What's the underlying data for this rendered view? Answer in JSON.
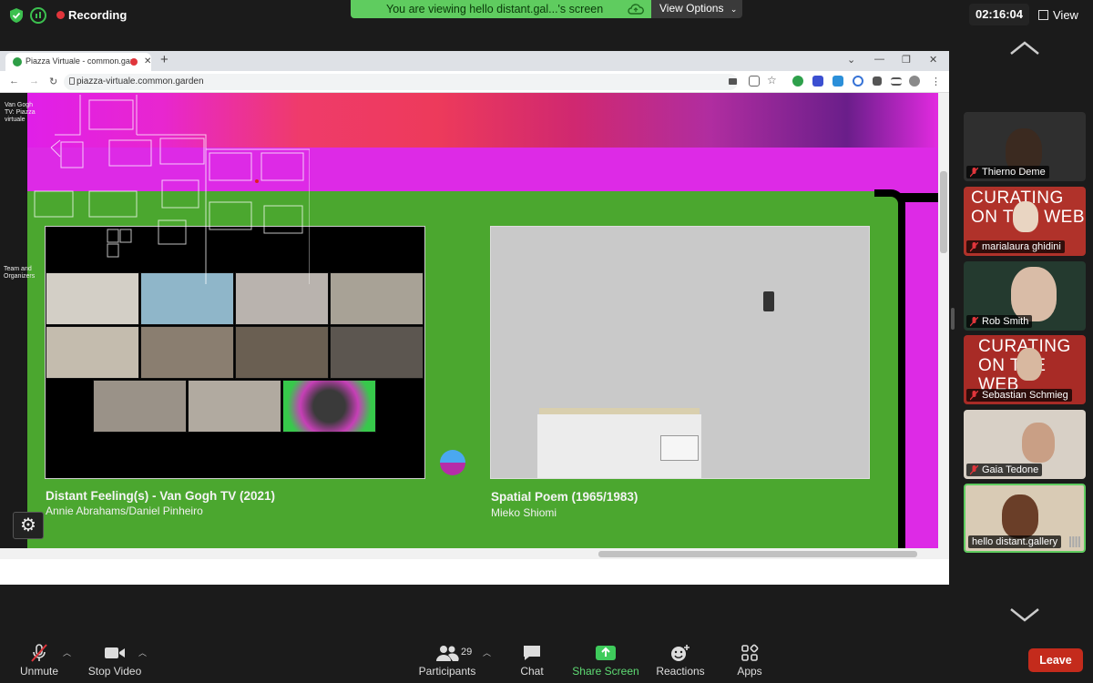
{
  "topbar": {
    "recording_label": "Recording",
    "banner_text": "You are viewing hello distant.gal...'s screen",
    "view_options_label": "View Options",
    "clock": "02:16:04",
    "view_label": "View"
  },
  "browser": {
    "tab_title": "Piazza Virtuale - common.gar",
    "url": "piazza-virtuale.common.garden"
  },
  "page": {
    "left_menu": [
      "Van Gogh TV: Piazza virtuale",
      "Team and Organizers"
    ],
    "artworks": [
      {
        "title": "Distant Feeling(s) - Van Gogh TV (2021)",
        "artist": "Annie Abrahams/Daniel Pinheiro"
      },
      {
        "title": "Spatial Poem (1965/1983)",
        "artist": "Mieko Shiomi"
      }
    ]
  },
  "gallery": [
    {
      "name": "Thierno Deme",
      "muted": true
    },
    {
      "name": "marialaura ghidini",
      "muted": true,
      "bg_text": "CURATING ON THE WEB"
    },
    {
      "name": "Rob Smith",
      "muted": true
    },
    {
      "name": "Sebastian Schmieg",
      "muted": true,
      "bg_text": "CURATING ON THE WEB"
    },
    {
      "name": "Gaia Tedone",
      "muted": true
    },
    {
      "name": "hello distant.gallery",
      "muted": false,
      "active": true
    }
  ],
  "toolbar": {
    "unmute": "Unmute",
    "stop_video": "Stop Video",
    "participants": "Participants",
    "participants_count": "29",
    "chat": "Chat",
    "share_screen": "Share Screen",
    "reactions": "Reactions",
    "apps": "Apps",
    "leave": "Leave"
  },
  "colors": {
    "zoom_green": "#5fcc5f",
    "leave_red": "#c42b1c",
    "page_green": "#4ba72f",
    "page_magenta": "#dd2ae6"
  }
}
